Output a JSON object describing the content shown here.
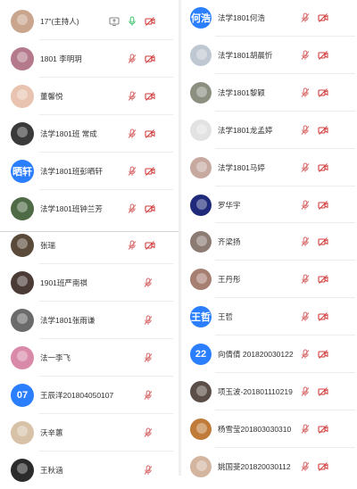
{
  "left": [
    {
      "name": "17\"(主持人)",
      "avatar": {
        "type": "photo",
        "color": "#c9a58e"
      },
      "host": true
    },
    {
      "name": "1801 李明玥",
      "avatar": {
        "type": "photo",
        "color": "#b47a8c"
      }
    },
    {
      "name": "董馨悦",
      "avatar": {
        "type": "photo",
        "color": "#e8c3b0"
      }
    },
    {
      "name": "法学1801班 常成",
      "avatar": {
        "type": "photo",
        "color": "#3a3a3a"
      }
    },
    {
      "name": "法学1801班彭晒轩",
      "avatar": {
        "type": "text",
        "text": "晒轩",
        "color": "#2b7fff"
      }
    },
    {
      "name": "法学1801班钟兰芳",
      "avatar": {
        "type": "photo",
        "color": "#4f6b45"
      }
    },
    {
      "name": "张瑞",
      "avatar": {
        "type": "photo",
        "color": "#5a4a3a"
      }
    },
    {
      "name": "1901班严南祺",
      "avatar": {
        "type": "photo",
        "color": "#4a3b36"
      }
    },
    {
      "name": "法学1801张雨谦",
      "avatar": {
        "type": "photo",
        "color": "#6b6b6b"
      }
    },
    {
      "name": "法一李飞",
      "avatar": {
        "type": "photo",
        "color": "#d98aa8"
      }
    },
    {
      "name": "王辰洋201804050107",
      "avatar": {
        "type": "text",
        "text": "07",
        "color": "#2b7fff"
      }
    },
    {
      "name": "沃辛蕙",
      "avatar": {
        "type": "photo",
        "color": "#d7c2a8"
      }
    },
    {
      "name": "王秋涵",
      "avatar": {
        "type": "photo",
        "color": "#2b2b2b"
      }
    }
  ],
  "right": [
    {
      "name": "法学1801何浩",
      "avatar": {
        "type": "text",
        "text": "何浩",
        "color": "#2b7fff"
      }
    },
    {
      "name": "法学1801胡晨忻",
      "avatar": {
        "type": "photo",
        "color": "#bfc7d2"
      }
    },
    {
      "name": "法学1801黎颖",
      "avatar": {
        "type": "photo",
        "color": "#8a8f80"
      }
    },
    {
      "name": "法学1801龙孟婷",
      "avatar": {
        "type": "photo",
        "color": "#e2e2e2"
      }
    },
    {
      "name": "法学1801马婷",
      "avatar": {
        "type": "photo",
        "color": "#c7a9a0"
      }
    },
    {
      "name": "罗华宇",
      "avatar": {
        "type": "photo",
        "color": "#1f2a7a"
      }
    },
    {
      "name": "齐梁扬",
      "avatar": {
        "type": "photo",
        "color": "#8b7b73"
      }
    },
    {
      "name": "王丹彤",
      "avatar": {
        "type": "photo",
        "color": "#a77e72"
      }
    },
    {
      "name": "王哲",
      "avatar": {
        "type": "text",
        "text": "王哲",
        "color": "#2b7fff"
      }
    },
    {
      "name": "向倩倩 201820030122",
      "avatar": {
        "type": "text",
        "text": "22",
        "color": "#2b7fff"
      }
    },
    {
      "name": "项玉波-201801110219",
      "avatar": {
        "type": "photo",
        "color": "#5b4d48"
      }
    },
    {
      "name": "杨雪莹201803030310",
      "avatar": {
        "type": "photo",
        "color": "#c07b3a"
      }
    },
    {
      "name": "姚国斐201820030112",
      "avatar": {
        "type": "photo",
        "color": "#d4b6a0"
      }
    }
  ],
  "colors": {
    "mic_muted": "#d96a6a",
    "mic_on": "#3cc26a",
    "video": "#d23b3b",
    "share": "#888888"
  },
  "icons": [
    "screen-share-icon",
    "mic-icon",
    "mic-muted-icon",
    "video-off-icon"
  ]
}
